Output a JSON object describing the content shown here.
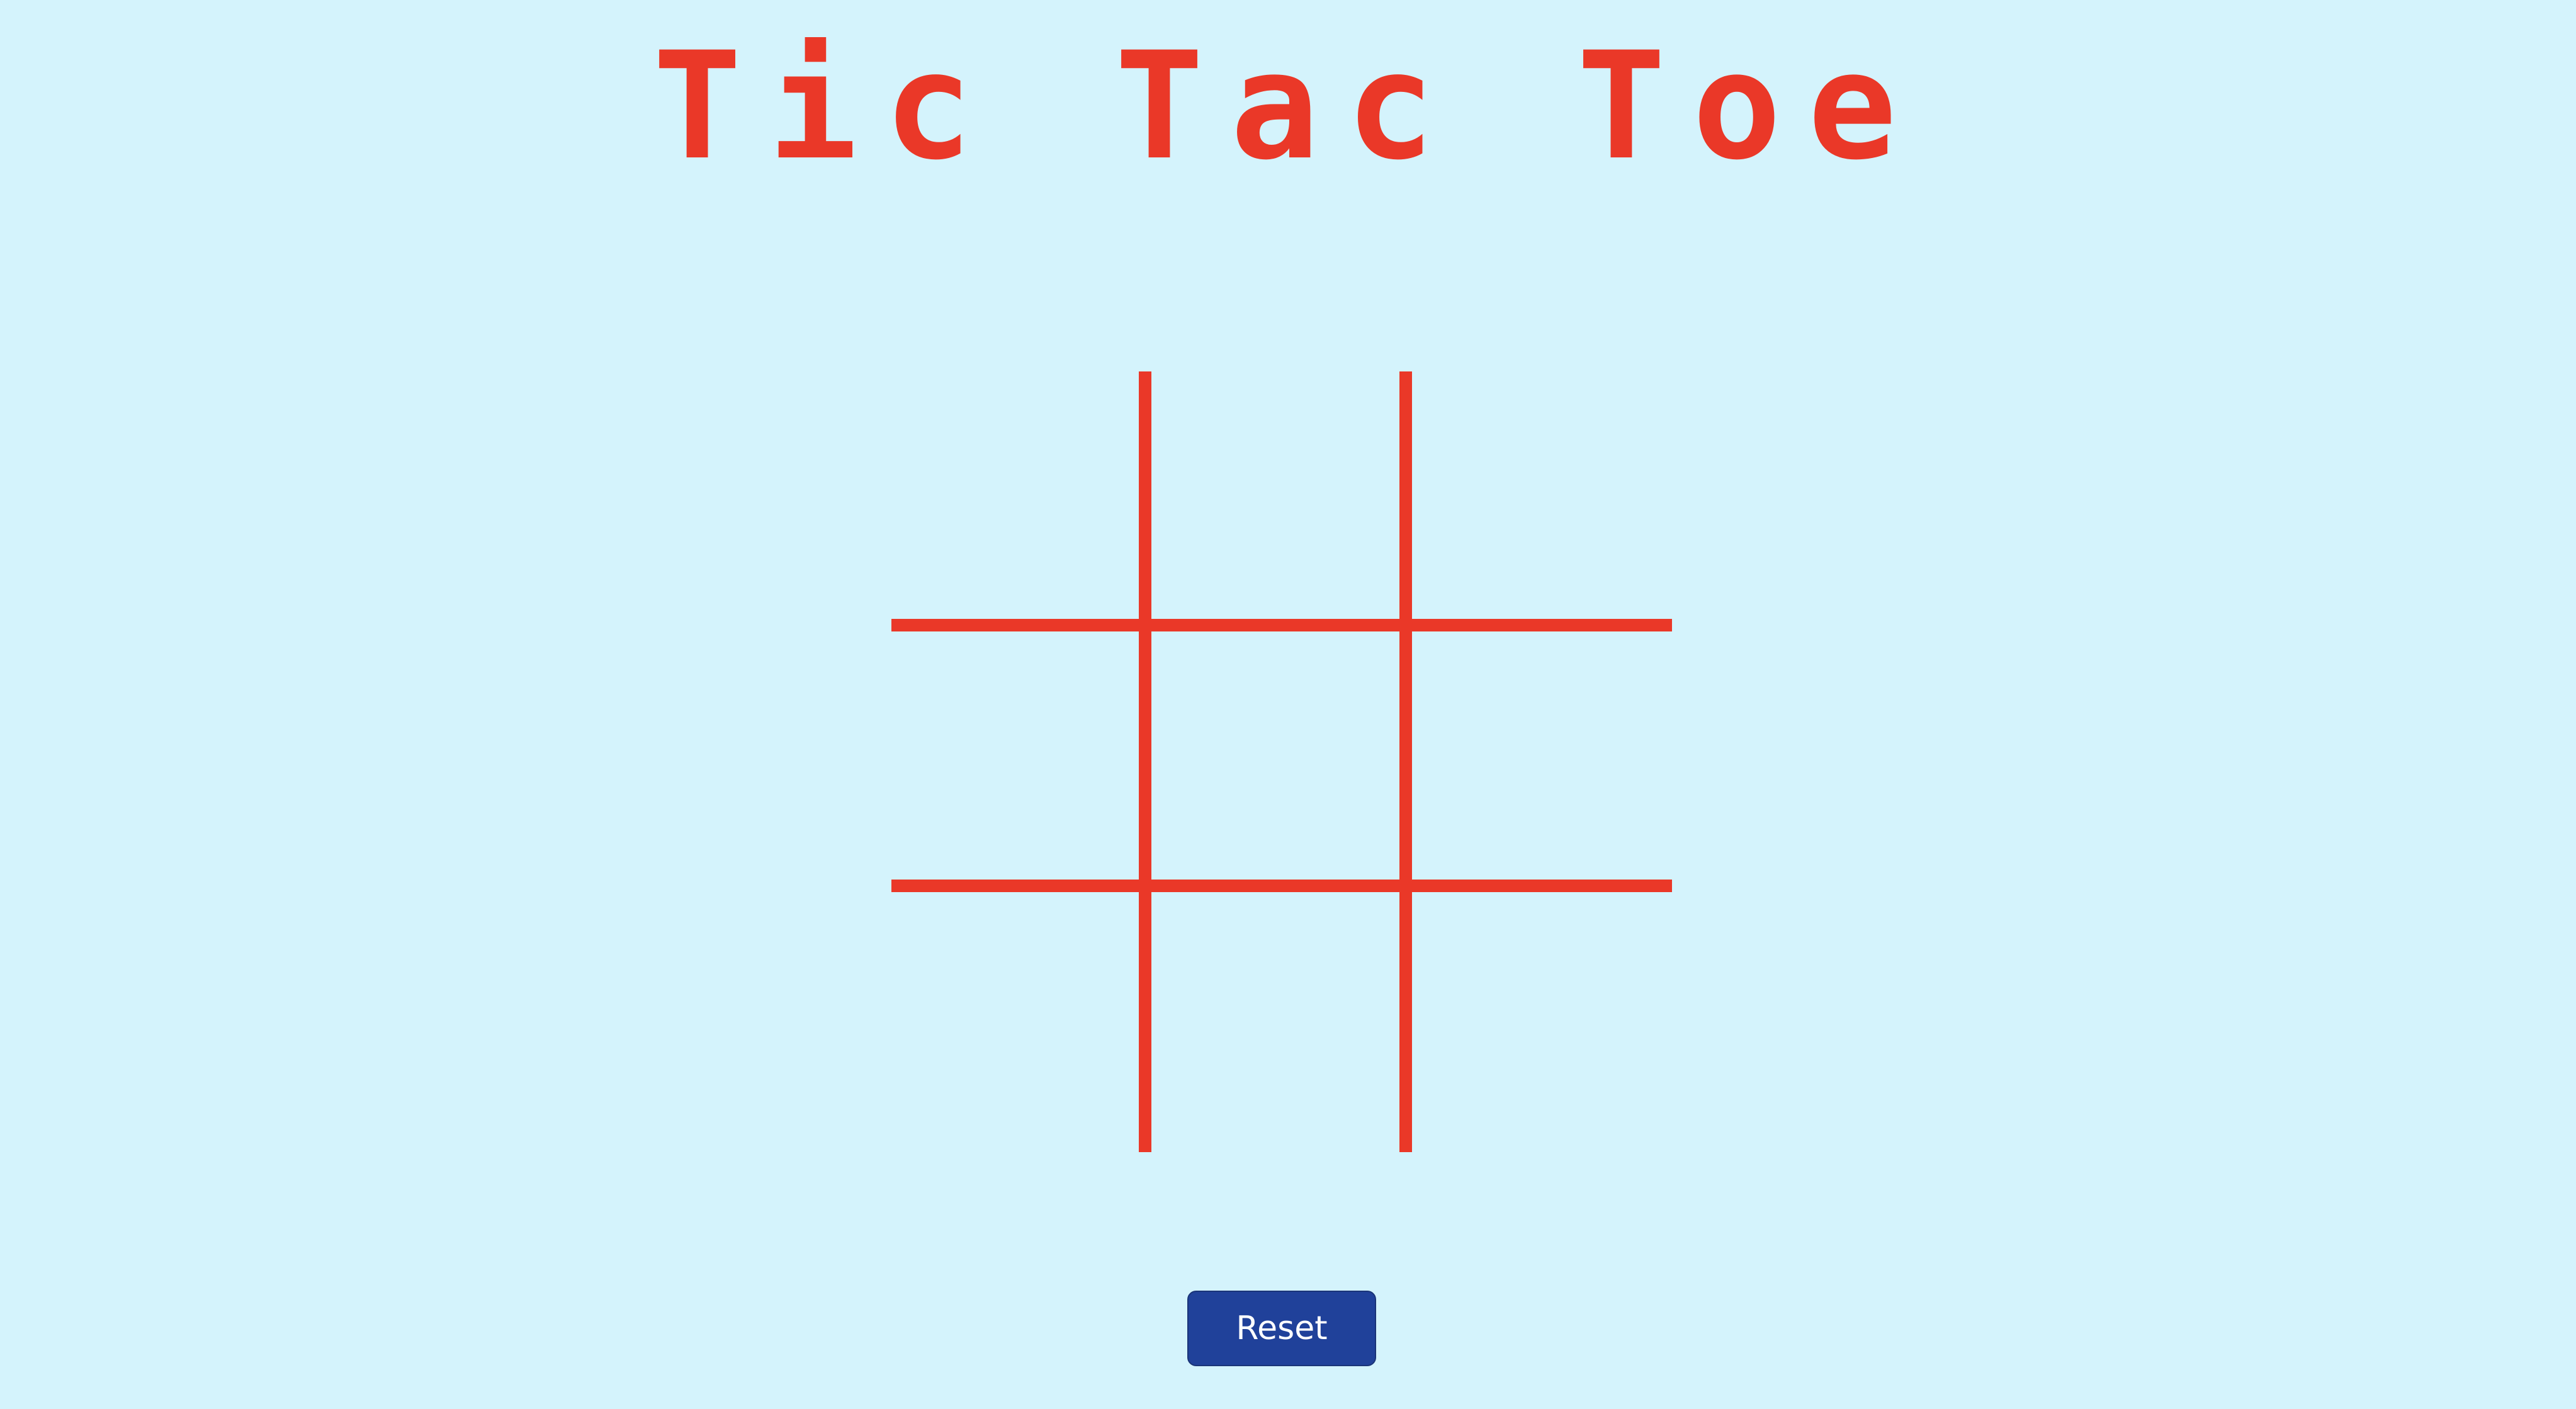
{
  "header": {
    "title": "Tic Tac Toe"
  },
  "board": {
    "cells": [
      "",
      "",
      "",
      "",
      "",
      "",
      "",
      "",
      ""
    ]
  },
  "controls": {
    "reset_label": "Reset"
  },
  "colors": {
    "background": "#d4f3fc",
    "accent": "#ea3828",
    "button": "#20419a",
    "button_text": "#ffffff"
  }
}
